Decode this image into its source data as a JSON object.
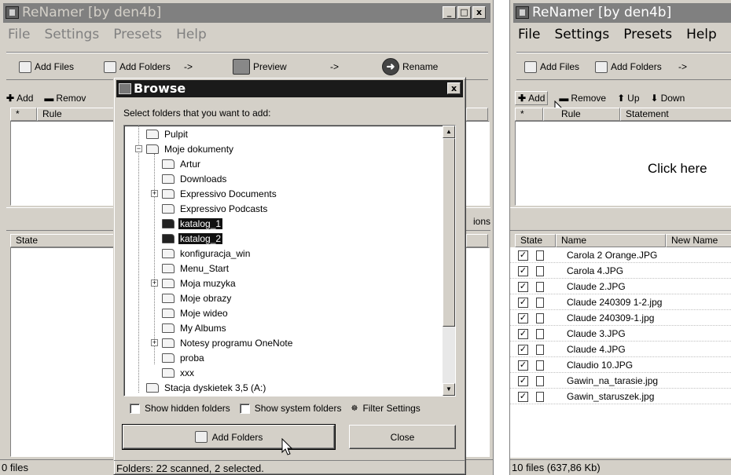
{
  "left_window": {
    "title": "ReNamer  [by den4b]",
    "menu": [
      "File",
      "Settings",
      "Presets",
      "Help"
    ],
    "toolbar": {
      "add_files": "Add Files",
      "add_folders": "Add Folders",
      "arrow1": "->",
      "preview": "Preview",
      "arrow2": "->",
      "rename": "Rename"
    },
    "rules_toolbar": {
      "add": "Add",
      "remove": "Remov"
    },
    "rules_header": {
      "star": "*",
      "rule": "Rule"
    },
    "options_fragment": "ions",
    "files_header": {
      "state": "State"
    },
    "status": "0 files",
    "caption_buttons": [
      "_",
      "□",
      "x"
    ]
  },
  "dialog": {
    "title": "Browse",
    "close": "x",
    "label": "Select folders that you want to add:",
    "tree": [
      {
        "label": "Pulpit",
        "selected": false
      },
      {
        "label": "Moje dokumenty",
        "selected": false
      },
      {
        "label": "Artur",
        "selected": false
      },
      {
        "label": "Downloads",
        "selected": false
      },
      {
        "label": "Expressivo Documents",
        "selected": false
      },
      {
        "label": "Expressivo Podcasts",
        "selected": false
      },
      {
        "label": "katalog_1",
        "selected": true
      },
      {
        "label": "katalog_2",
        "selected": true
      },
      {
        "label": "konfiguracja_win",
        "selected": false
      },
      {
        "label": "Menu_Start",
        "selected": false
      },
      {
        "label": "Moja muzyka",
        "selected": false
      },
      {
        "label": "Moje obrazy",
        "selected": false
      },
      {
        "label": "Moje wideo",
        "selected": false
      },
      {
        "label": "My Albums",
        "selected": false
      },
      {
        "label": "Notesy programu OneNote",
        "selected": false
      },
      {
        "label": "proba",
        "selected": false
      },
      {
        "label": "xxx",
        "selected": false
      },
      {
        "label": "Stacja dyskietek 3,5 (A:)",
        "selected": false
      }
    ],
    "show_hidden": "Show hidden folders",
    "show_system": "Show system folders",
    "filter_settings": "Filter Settings",
    "add_folders_btn": "Add Folders",
    "close_btn": "Close",
    "status": "Folders: 22 scanned, 2 selected."
  },
  "right_window": {
    "title": "ReNamer  [by den4b]",
    "menu": [
      "File",
      "Settings",
      "Presets",
      "Help"
    ],
    "toolbar": {
      "add_files": "Add Files",
      "add_folders": "Add Folders",
      "arrow1": "->"
    },
    "rules_toolbar": {
      "add": "Add",
      "remove": "Remove",
      "up": "Up",
      "down": "Down"
    },
    "rules_header": {
      "star": "*",
      "rule": "Rule",
      "statement": "Statement"
    },
    "click_here": "Click here",
    "files_header": {
      "state": "State",
      "name": "Name",
      "new_name": "New Name"
    },
    "files": [
      "Carola 2 Orange.JPG",
      "Carola 4.JPG",
      "Claude 2.JPG",
      "Claude 240309 1-2.jpg",
      "Claude 240309-1.jpg",
      "Claude 3.JPG",
      "Claude 4.JPG",
      "Claudio 10.JPG",
      "Gawin_na_tarasie.jpg",
      "Gawin_staruszek.jpg"
    ],
    "status": "10 files (637,86 Kb)"
  }
}
